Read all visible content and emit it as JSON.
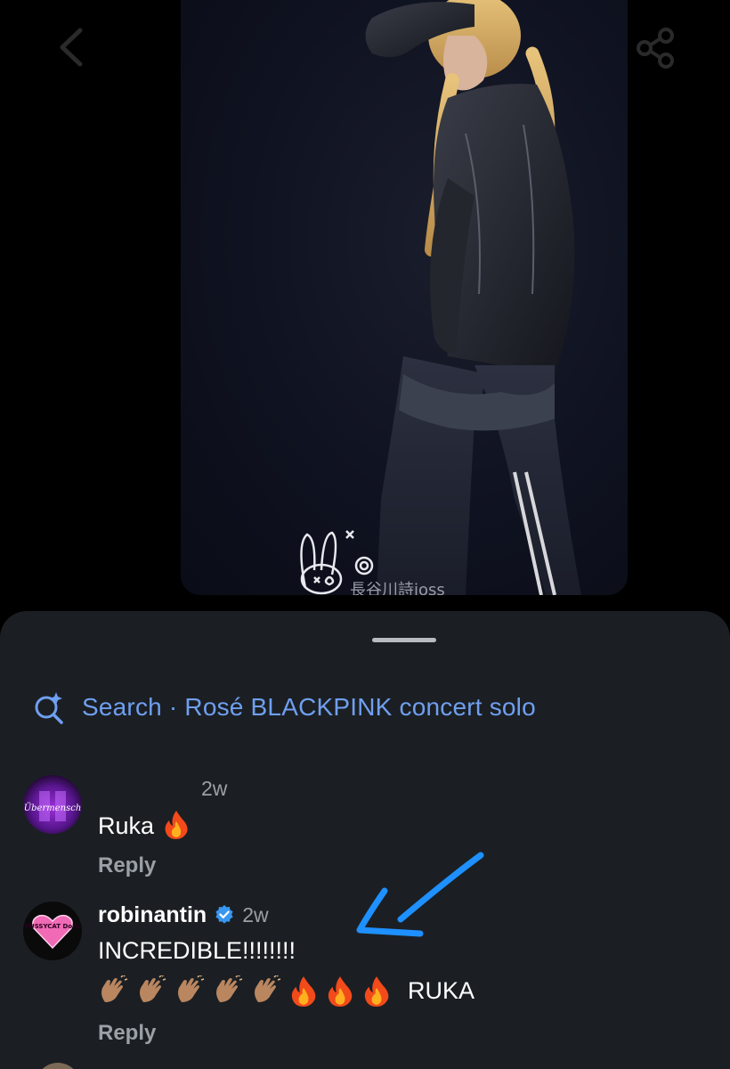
{
  "search": {
    "label": "Search · Rosé BLACKPINK concert solo"
  },
  "media": {
    "watermark": "長谷川詩joss"
  },
  "comments": [
    {
      "username": "",
      "avatar_text": "Übermensch",
      "time": "2w",
      "text": "Ruka",
      "reply_label": "Reply"
    },
    {
      "username": "robinantin",
      "verified": true,
      "avatar_text": "PUSSYCAT Dolls",
      "time": "2w",
      "text": "INCREDIBLE!!!!!!!!",
      "emoji_suffix_text": "RUKA",
      "reply_label": "Reply"
    }
  ],
  "colors": {
    "background": "#000000",
    "sheet": "#1b1f23",
    "link_blue": "#6f9ff0",
    "secondary_text": "#9aa0a6",
    "verified_blue": "#3897f0",
    "annotation_arrow": "#1e90ff"
  }
}
